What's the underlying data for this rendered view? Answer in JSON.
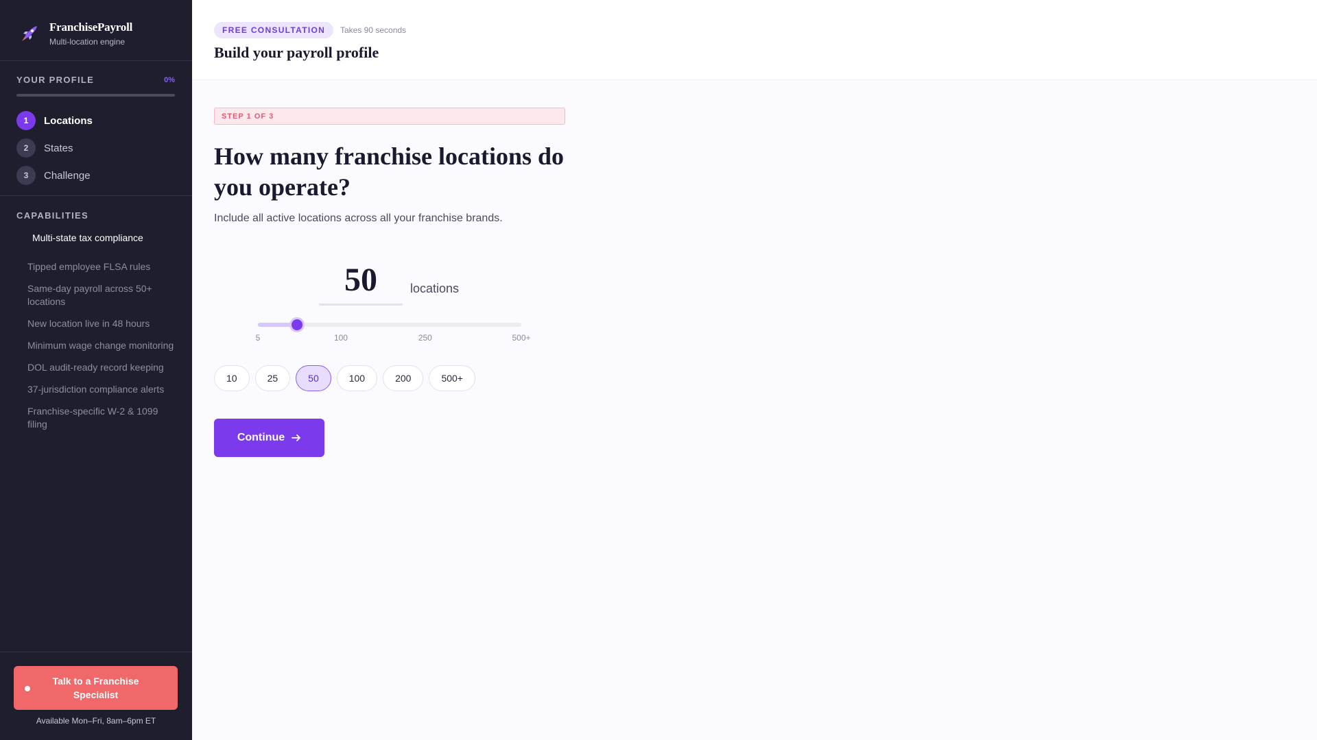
{
  "brand": {
    "name": "FranchisePayroll",
    "subtitle": "Multi-location engine",
    "logo_icon": "rocket-icon"
  },
  "profile": {
    "label": "YOUR PROFILE",
    "progress_text": "0%",
    "progress": 0,
    "steps": [
      {
        "number": "1",
        "label": "Locations",
        "active": true
      },
      {
        "number": "2",
        "label": "States",
        "active": false
      },
      {
        "number": "3",
        "label": "Challenge",
        "active": false
      }
    ]
  },
  "capabilities": {
    "label": "CAPABILITIES",
    "items": [
      "Multi-state tax compliance",
      "Tipped employee FLSA rules",
      "Same-day payroll across 50+ locations",
      "New location live in 48 hours",
      "Minimum wage change monitoring",
      "DOL audit-ready record keeping",
      "37-jurisdiction compliance alerts",
      "Franchise-specific W-2 & 1099 filing"
    ],
    "active_index": 0
  },
  "cta": {
    "label": "Talk to a Franchise Specialist",
    "availability": "Available Mon–Fri, 8am–6pm ET"
  },
  "header": {
    "badge": "FREE CONSULTATION",
    "duration": "Takes 90 seconds",
    "title": "Build your payroll profile"
  },
  "question": {
    "step_label": "STEP 1 OF 3",
    "title": "How many franchise locations do you operate?",
    "hint": "Include all active locations across all your franchise brands."
  },
  "locations": {
    "value": "50",
    "unit": "locations",
    "slider": {
      "min": 5,
      "max": 500,
      "value": 50,
      "ticks": [
        {
          "label": "5",
          "value": 5
        },
        {
          "label": "100",
          "value": 100
        },
        {
          "label": "250",
          "value": 250
        },
        {
          "label": "500+",
          "value": 500
        }
      ]
    },
    "presets": [
      "10",
      "25",
      "50",
      "100",
      "200",
      "500+"
    ],
    "selected_preset": "50"
  },
  "continue_label": "Continue",
  "colors": {
    "accent": "#7c3aed",
    "cta": "#f0686a",
    "step_banner": "#e35a75",
    "sidebar": "#1f1e2f"
  }
}
